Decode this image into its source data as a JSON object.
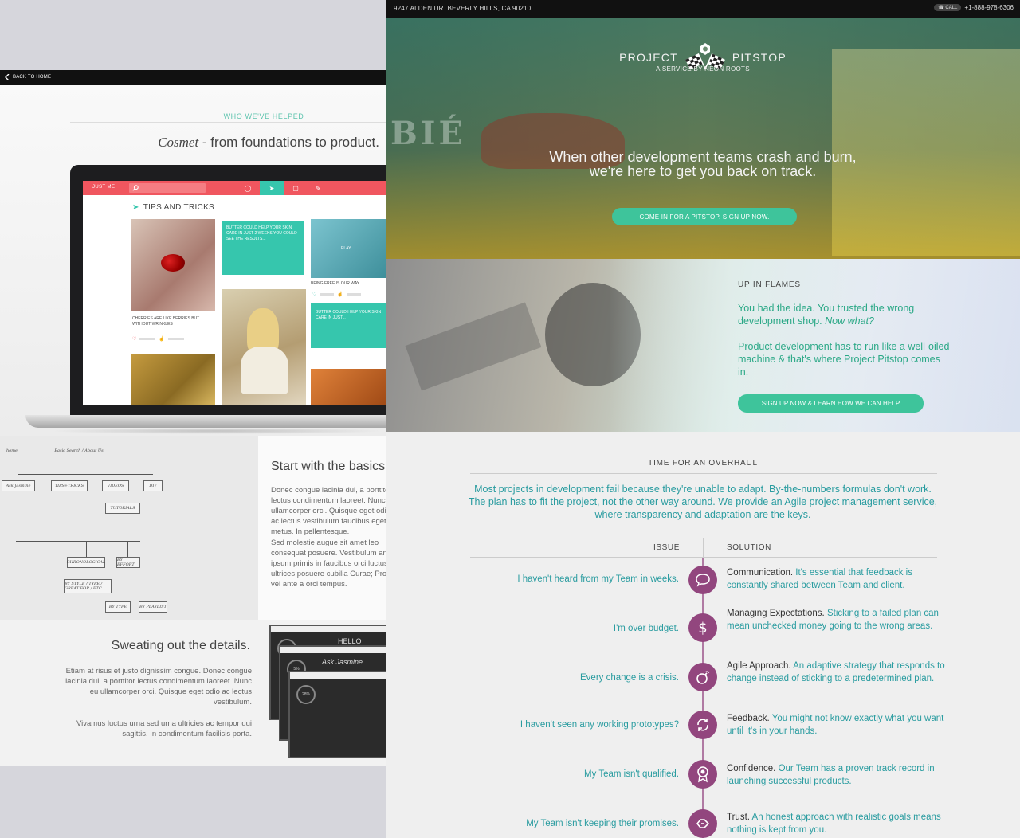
{
  "left": {
    "back_label": "BACK TO HOME",
    "helped_label": "WHO WE'VE HELPED",
    "cosmet_name": "Cosmet",
    "cosmet_rest": " - from foundations to product.",
    "app": {
      "brand": "JUST ME",
      "section_title": "TIPS AND TRICKS",
      "tile1_caption": "CHERRIES ARE LIKE BERRIES BUT WITHOUT WRINKLES",
      "tile2_caption": "BUTTER COULD HELP YOUR SKIN CARE IN JUST 2 WEEKS YOU COULD SEE THE RESULTS...",
      "tile5_play": "PLAY",
      "tile5_caption": "BEING FREE IS OUR WAY...",
      "tile6_caption": "BUTTER COULD HELP YOUR SKIN CARE IN JUST..."
    },
    "basics": {
      "title": "Start with the basics.",
      "p1": "Donec congue lacinia dui, a porttitor lectus condimentum laoreet. Nunc eu ullamcorper orci. Quisque eget odio ac lectus vestibulum faucibus eget in metus. In pellentesque.",
      "p2": "Sed molestie augue sit amet leo consequat posuere. Vestibulum ante ipsum primis in faucibus orci luctus et ultrices posuere cubilia Curae; Proin vel ante a orci tempus."
    },
    "sketch": {
      "home": "home",
      "basic_search": "Basic Search / About Us",
      "ask": "Ask Jasmine",
      "tips": "TIPS+TRICKS",
      "videos": "VIDEOS",
      "diy": "DIY",
      "tutorials": "TUTORIALS",
      "chronological": "CHRONOLOGICAL",
      "by_style": "BY STYLE / TYPE / GREAT FOR / ETC",
      "by_effort": "BY EFFORT",
      "by_type": "BY TYPE",
      "by_playlist": "BY PLAYLIST"
    },
    "details": {
      "title": "Sweating out the details.",
      "p1": "Etiam at risus et justo dignissim congue. Donec congue lacinia dui, a porttitor lectus condimentum laoreet. Nunc eu ullamcorper orci. Quisque eget odio ac lectus vestibulum.",
      "p2": "Vivamus luctus urna sed urna ultricies ac tempor dui sagittis. In condimentum facilisis porta.",
      "mock_hello": "HELLO",
      "mock_ask": "Ask",
      "mock_jasmine": "Jasmine",
      "mock_pct1": "0%",
      "mock_pct2": "5%",
      "mock_pct3": "28%"
    }
  },
  "right": {
    "address": "9247 ALDEN DR. BEVERLY HILLS, CA 90210",
    "call_label": "CALL",
    "phone": "+1-888-978-6306",
    "brand_left": "PROJECT",
    "brand_right": "PITSTOP",
    "brand_sub": "A SERVICE BY NEON ROOTS",
    "hero_line1": "When other development teams crash and burn,",
    "hero_line2": "we're here to get you back on track.",
    "hero_cta": "COME IN FOR A PITSTOP. SIGN UP NOW.",
    "flames_label": "UP IN FLAMES",
    "flames_p1_a": "You had the idea.  You trusted the wrong development shop.  ",
    "flames_p1_b": "Now what?",
    "flames_p2": "Product development has to run like a well-oiled machine & that's where Project Pitstop comes in.",
    "flames_cta": "SIGN UP NOW & LEARN HOW WE CAN HELP",
    "overhaul_title": "TIME FOR AN OVERHAUL",
    "overhaul_body": "Most projects in development fail because they're unable to adapt.  By-the-numbers formulas don't work.  The plan has to fit the project, not the other way around.  We provide an Agile project management service, where transparency and adaptation are the keys.",
    "col_issue": "ISSUE",
    "col_solution": "SOLUTION",
    "rows": [
      {
        "issue": "I haven't heard from my Team in weeks.",
        "lead": "Communication.",
        "text": "It's essential that feedback is constantly shared between Team and client.",
        "icon": "chat-icon"
      },
      {
        "issue": "I'm over budget.",
        "lead": "Managing Expectations.",
        "text": "Sticking to a failed plan can mean unchecked money going to the wrong areas.",
        "icon": "dollar-icon"
      },
      {
        "issue": "Every change is a crisis.",
        "lead": "Agile Approach.",
        "text": "An adaptive strategy that responds to change instead of sticking to a predetermined plan.",
        "icon": "bomb-icon"
      },
      {
        "issue": "I haven't seen any working prototypes?",
        "lead": "Feedback.",
        "text": "You might not know exactly what you want until it's in your hands.",
        "icon": "refresh-icon"
      },
      {
        "issue": "My Team isn't qualified.",
        "lead": "Confidence.",
        "text": "Our Team has a proven track record in launching successful products.",
        "icon": "award-icon"
      },
      {
        "issue": "My Team isn't keeping their promises.",
        "lead": "Trust.",
        "text": "An honest approach with realistic goals means nothing is kept from you.",
        "icon": "handshake-icon"
      }
    ]
  },
  "colors": {
    "teal": "#2a9ca0",
    "green": "#3ec49b",
    "purple": "#92467e",
    "coral": "#f0565f"
  }
}
